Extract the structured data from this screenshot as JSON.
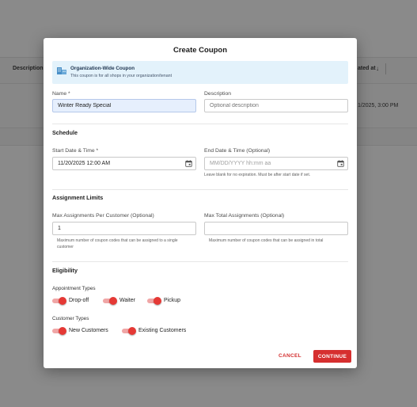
{
  "background": {
    "columns": {
      "description": "Description",
      "created_at": "ated at"
    },
    "row_date": "1/2025, 3:00 PM"
  },
  "modal": {
    "title": "Create Coupon",
    "info": {
      "title": "Organization-Wide Coupon",
      "subtitle": "This coupon is for all shops in your organization/tenant"
    },
    "name": {
      "label": "Name *",
      "value": "Winter Ready Special"
    },
    "description": {
      "label": "Description",
      "placeholder": "Optional description"
    },
    "schedule": {
      "title": "Schedule",
      "start": {
        "label": "Start Date & Time *",
        "value": "11/20/2025 12:00 AM"
      },
      "end": {
        "label": "End Date & Time (Optional)",
        "placeholder": "MM/DD/YYYY hh:mm aa",
        "helper": "Leave blank for no expiration. Must be after start date if set."
      }
    },
    "limits": {
      "title": "Assignment Limits",
      "per_customer": {
        "label": "Max Assignments Per Customer (Optional)",
        "value": "1",
        "helper": "Maximum number of coupon codes that can be assigned to a single customer"
      },
      "total": {
        "label": "Max Total Assignments (Optional)",
        "value": "",
        "helper": "Maximum number of coupon codes that can be assigned in total"
      }
    },
    "eligibility": {
      "title": "Eligibility",
      "appointment_types": {
        "title": "Appointment Types",
        "items": [
          {
            "label": "Drop-off",
            "on": true
          },
          {
            "label": "Waiter",
            "on": true
          },
          {
            "label": "Pickup",
            "on": true
          }
        ]
      },
      "customer_types": {
        "title": "Customer Types",
        "items": [
          {
            "label": "New Customers",
            "on": true
          },
          {
            "label": "Existing Customers",
            "on": true
          }
        ]
      }
    },
    "actions": {
      "cancel": "CANCEL",
      "continue": "CONTINUE"
    }
  },
  "colors": {
    "accent": "#d62f2f",
    "info_bg": "#e3f2fb",
    "overlay": "#8a8a8a"
  },
  "icons": [
    "building-icon",
    "calendar-icon",
    "arrow-down-icon"
  ]
}
